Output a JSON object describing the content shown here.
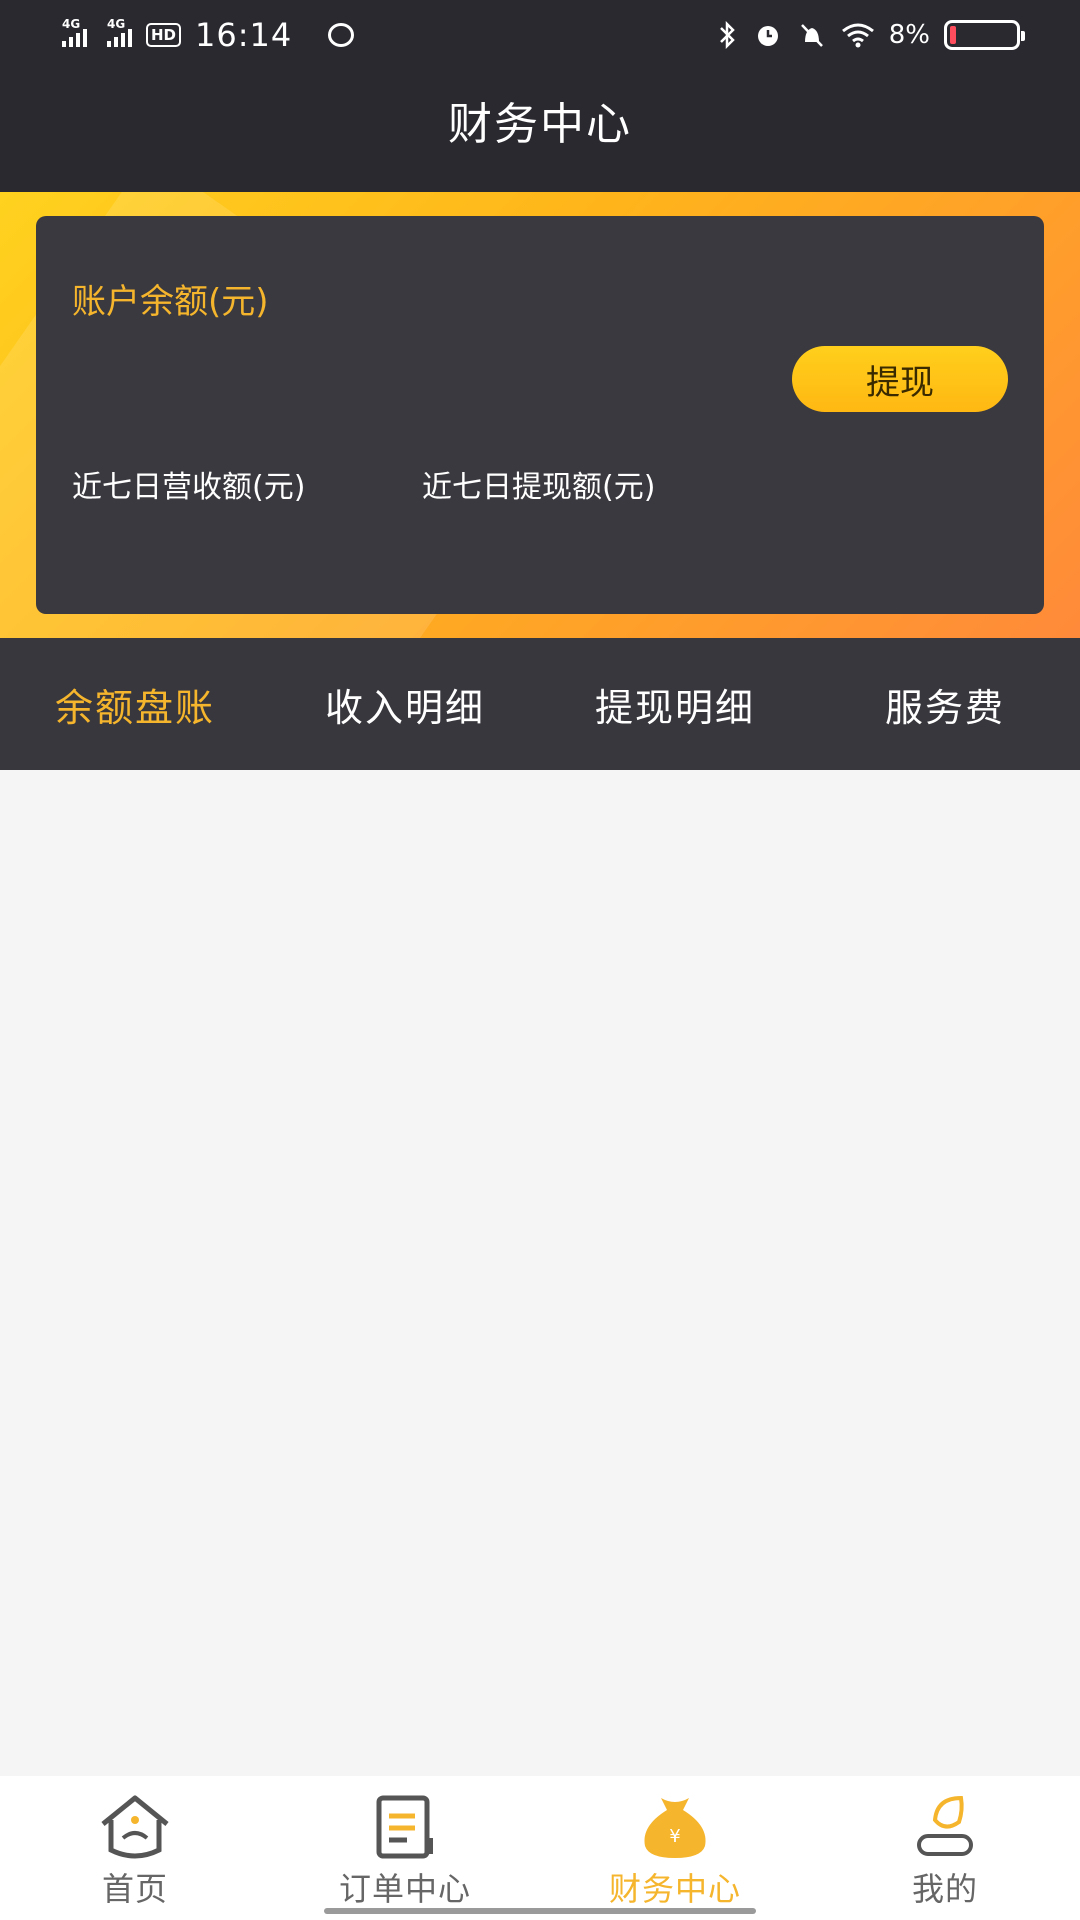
{
  "status_bar": {
    "network_1": "4G",
    "network_2": "4G",
    "hd": "HD",
    "time": "16:14",
    "battery_percent": "8%",
    "battery_level": 0.08
  },
  "header": {
    "title": "财务中心"
  },
  "balance_card": {
    "balance_label": "账户余额(元)",
    "withdraw_button": "提现",
    "income_7day_label": "近七日营收额(元)",
    "withdraw_7day_label": "近七日提现额(元)"
  },
  "tabs": [
    {
      "label": "余额盘账",
      "active": true
    },
    {
      "label": "收入明细",
      "active": false
    },
    {
      "label": "提现明细",
      "active": false
    },
    {
      "label": "服务费",
      "active": false
    }
  ],
  "bottom_nav": [
    {
      "label": "首页",
      "icon": "home-icon",
      "active": false
    },
    {
      "label": "订单中心",
      "icon": "order-icon",
      "active": false
    },
    {
      "label": "财务中心",
      "icon": "money-bag-icon",
      "active": true
    },
    {
      "label": "我的",
      "icon": "profile-icon",
      "active": false
    }
  ],
  "colors": {
    "accent": "#f5b52c",
    "dark_bg": "#2a2930",
    "card_bg": "#3a393f",
    "hero_gradient_start": "#ffd21f",
    "hero_gradient_end": "#ff8a3a"
  }
}
